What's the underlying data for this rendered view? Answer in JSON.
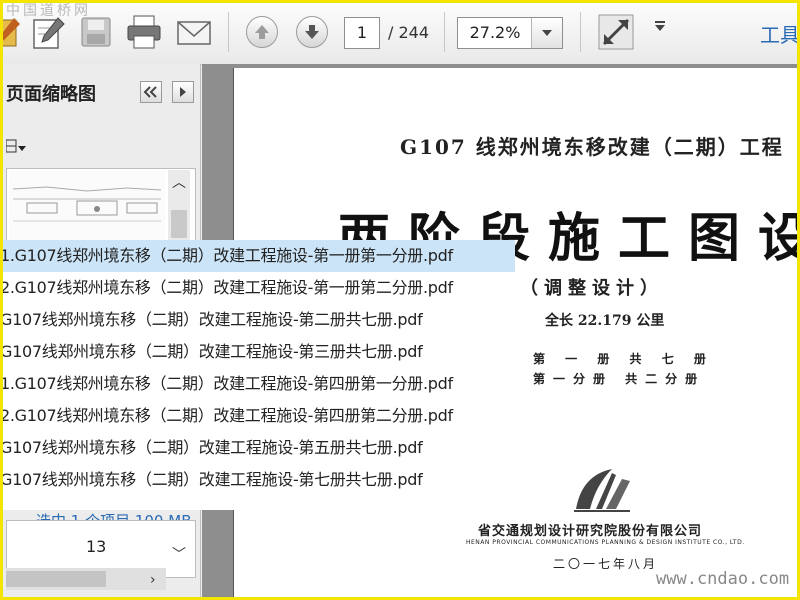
{
  "watermark_top": "中国道桥网",
  "watermark_bottom": "www.cndao.com",
  "toolbar": {
    "page_current": "1",
    "page_total": "/ 244",
    "zoom": "27.2%",
    "tools_label": "工具"
  },
  "left_panel": {
    "title": "页面缩略图",
    "options_icon": "options-menu-icon",
    "page_number": "13",
    "status": "选中 1 个项目 100 MB"
  },
  "document": {
    "title": "G107 线郑州境东移改建（二期）工程",
    "big_title": "两阶段施工图设",
    "subtitle": "（调整设计）",
    "length": "全长 22.179 公里",
    "volume_line1": "第 一 册   共 七 册",
    "volume_line2": "第一分册   共二分册",
    "institute": "省交通规划设计研究院股份有限公司",
    "institute_en": "HENAN PROVINCIAL COMMUNICATIONS PLANNING & DESIGN INSTITUTE CO., LTD.",
    "date": "二〇一七年八月"
  },
  "file_list": {
    "items": [
      "1.G107线郑州境东移（二期）改建工程施设-第一册第一分册.pdf",
      "2.G107线郑州境东移（二期）改建工程施设-第一册第二分册.pdf",
      "G107线郑州境东移（二期）改建工程施设-第二册共七册.pdf",
      "G107线郑州境东移（二期）改建工程施设-第三册共七册.pdf",
      "1.G107线郑州境东移（二期）改建工程施设-第四册第一分册.pdf",
      "2.G107线郑州境东移（二期）改建工程施设-第四册第二分册.pdf",
      "G107线郑州境东移（二期）改建工程施设-第五册共七册.pdf",
      "G107线郑州境东移（二期）改建工程施设-第七册共七册.pdf"
    ],
    "selected_index": 0
  },
  "colors": {
    "frame": "#f5e400",
    "selection": "#cce4f7",
    "accent": "#2a6bb5"
  }
}
